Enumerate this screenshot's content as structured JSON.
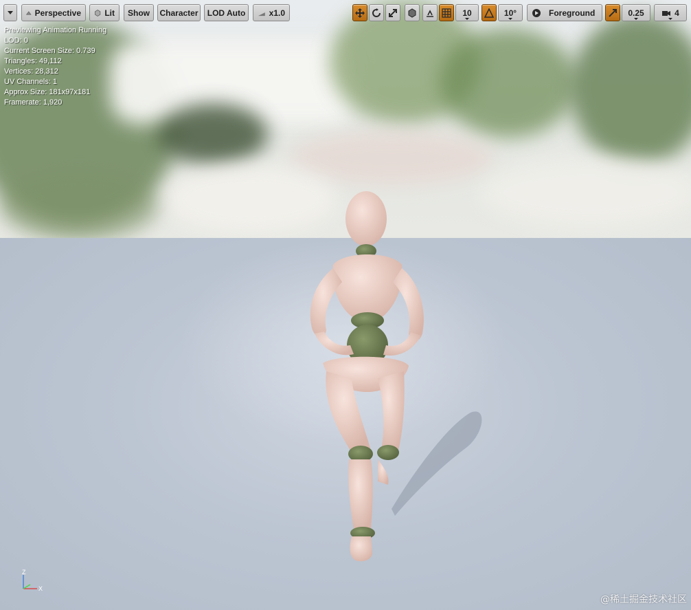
{
  "toolbar": {
    "menu_label": "",
    "view_mode": "Perspective",
    "lighting": "Lit",
    "show": "Show",
    "character": "Character",
    "lod": "LOD Auto",
    "speed": "x1.0",
    "grid_snap": "10",
    "rotation_snap": "10°",
    "layer": "Foreground",
    "scale_snap": "0.25",
    "camera_speed": "4"
  },
  "stats": {
    "line1": "Previewing Animation Running",
    "line2": "LOD: 0",
    "line3": "Current Screen Size: 0.739",
    "line4": "Triangles: 49,112",
    "line5": "Vertices: 28,312",
    "line6": "UV Channels: 1",
    "line7": "Approx Size: 181x97x181",
    "line8": "Framerate: 1,920"
  },
  "axis": {
    "z": "Z",
    "x": "X"
  },
  "watermark": "@稀土掘金技术社区",
  "colors": {
    "accent": "#c97a1e",
    "toolbar_bg": "#d0d0d0",
    "floor": "#bcc5d2",
    "mannequin": "#e8cdc3",
    "joints": "#6f7f55"
  }
}
